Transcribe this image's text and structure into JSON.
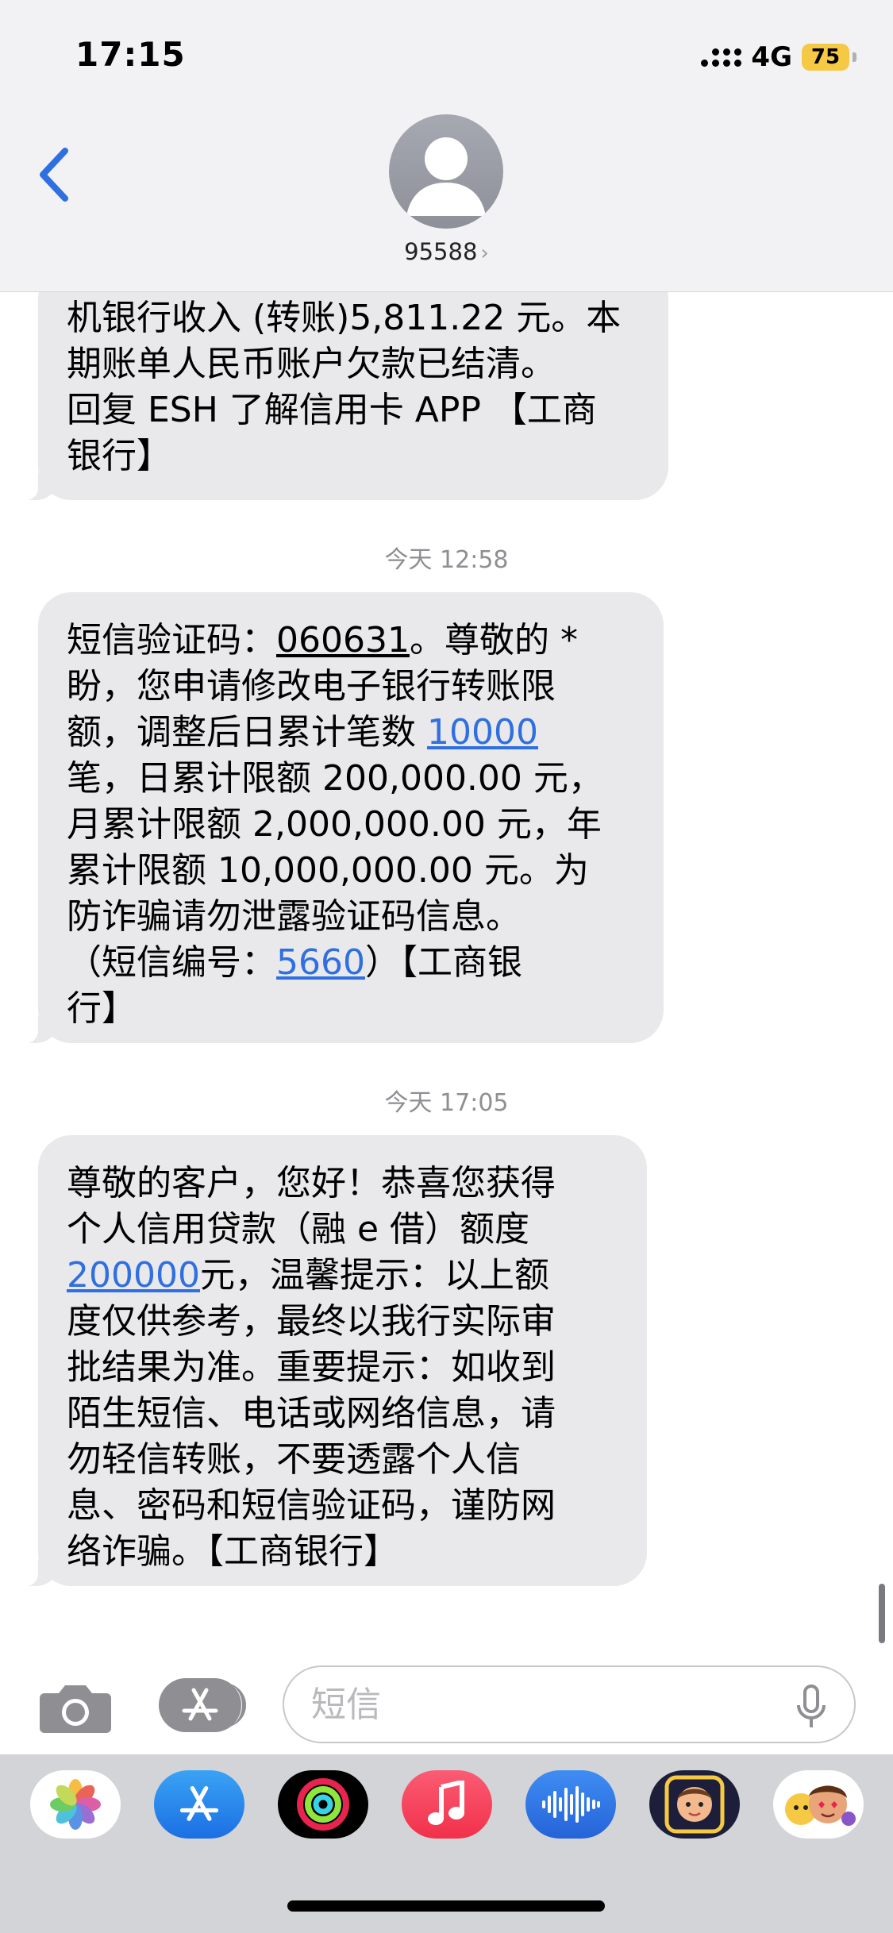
{
  "status_bar": {
    "time": "17:15",
    "network": "4G",
    "battery": "75"
  },
  "header": {
    "contact": "95588",
    "chevron": "›",
    "back_icon": "chevron-left-icon"
  },
  "messages": [
    {
      "lines": [
        [
          {
            "t": "机银行收入 (转账)5,811.22 元。本"
          }
        ],
        [
          {
            "t": "期账单人民币账户欠款已结清。"
          }
        ],
        [
          {
            "t": "回复 ESH 了解信用卡 APP 【工商"
          }
        ],
        [
          {
            "t": "银行】"
          }
        ]
      ]
    },
    {
      "timestamp": "今天 12:58",
      "lines": [
        [
          {
            "t": "短信验证码："
          },
          {
            "t": "060631",
            "style": "under"
          },
          {
            "t": "。尊敬的 *"
          }
        ],
        [
          {
            "t": "盼，您申请修改电子银行转账限"
          }
        ],
        [
          {
            "t": "额，调整后日累计笔数 "
          },
          {
            "t": "10000",
            "style": "link"
          }
        ],
        [
          {
            "t": "笔，日累计限额 200,000.00 元，"
          }
        ],
        [
          {
            "t": "月累计限额 2,000,000.00 元，年"
          }
        ],
        [
          {
            "t": "累计限额 10,000,000.00 元。为"
          }
        ],
        [
          {
            "t": "防诈骗请勿泄露验证码信息。"
          }
        ],
        [
          {
            "t": "（短信编号："
          },
          {
            "t": "5660",
            "style": "link"
          },
          {
            "t": "）【工商银"
          }
        ],
        [
          {
            "t": "行】"
          }
        ]
      ]
    },
    {
      "timestamp": "今天 17:05",
      "lines": [
        [
          {
            "t": "尊敬的客户，您好！恭喜您获得"
          }
        ],
        [
          {
            "t": "个人信用贷款（融 e 借）额度"
          }
        ],
        [
          {
            "t": "200000",
            "style": "link"
          },
          {
            "t": "元，温馨提示：以上额"
          }
        ],
        [
          {
            "t": "度仅供参考，最终以我行实际审"
          }
        ],
        [
          {
            "t": "批结果为准。重要提示：如收到"
          }
        ],
        [
          {
            "t": "陌生短信、电话或网络信息，请"
          }
        ],
        [
          {
            "t": "勿轻信转账，不要透露个人信"
          }
        ],
        [
          {
            "t": "息、密码和短信验证码，谨防网"
          }
        ],
        [
          {
            "t": "络诈骗。【工商银行】"
          }
        ]
      ]
    }
  ],
  "input": {
    "placeholder": "短信",
    "value": ""
  },
  "app_drawer": [
    "photos-icon",
    "app-store-icon",
    "fitness-icon",
    "music-icon",
    "voice-memo-icon",
    "memoji-camera-icon",
    "memoji-stickers-icon"
  ],
  "colors": {
    "bubble": "#e9e9eb",
    "link": "#2f6fe0",
    "battery": "#f6c945",
    "timestamp": "#8e8e93"
  }
}
